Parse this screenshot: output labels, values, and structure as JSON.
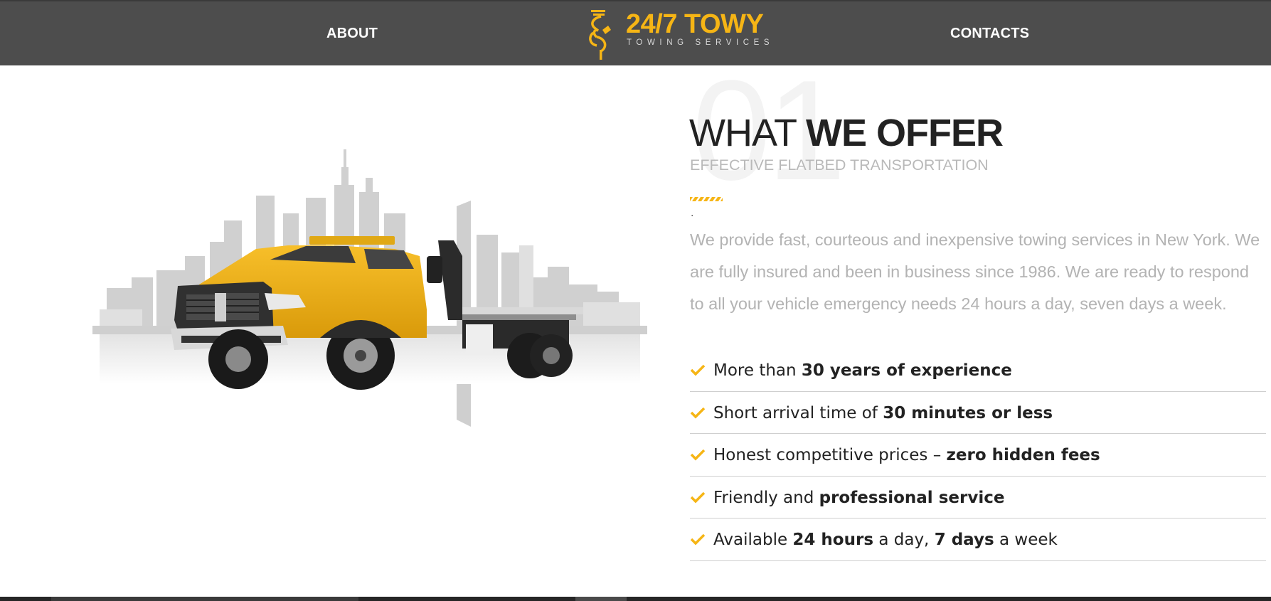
{
  "nav": {
    "about_label": "ABOUT",
    "contacts_label": "CONTACTS"
  },
  "logo": {
    "title": "24/7 TOWY",
    "subtitle": "TOWING SERVICES",
    "icon": "tow-hook-icon"
  },
  "hero_image": "tow-truck-city-skyline",
  "section": {
    "number": "01",
    "heading_light": "WHAT ",
    "heading_bold": "WE OFFER",
    "subheading": "EFFECTIVE FLATBED TRANSPORTATION",
    "dot": ".",
    "intro": "We provide fast, courteous and inexpensive towing services in New York. We are fully insured and been in business since 1986. We are ready to respond to all your vehicle emergency needs 24 hours a day, seven days a week."
  },
  "features": [
    {
      "parts": [
        "More than ",
        "30 years of experience"
      ]
    },
    {
      "parts": [
        "Short arrival time of ",
        "30 minutes or less"
      ]
    },
    {
      "parts": [
        "Honest competitive prices – ",
        "zero hidden fees"
      ]
    },
    {
      "parts": [
        "Friendly and ",
        "professional service"
      ]
    },
    {
      "parts": [
        "Available ",
        "24 hours",
        " a day, ",
        "7 days",
        " a week"
      ]
    }
  ],
  "colors": {
    "accent": "#f6b515",
    "header_bg": "#4d4d4d",
    "text_dark": "#222222",
    "text_muted": "#b3b3b3"
  }
}
